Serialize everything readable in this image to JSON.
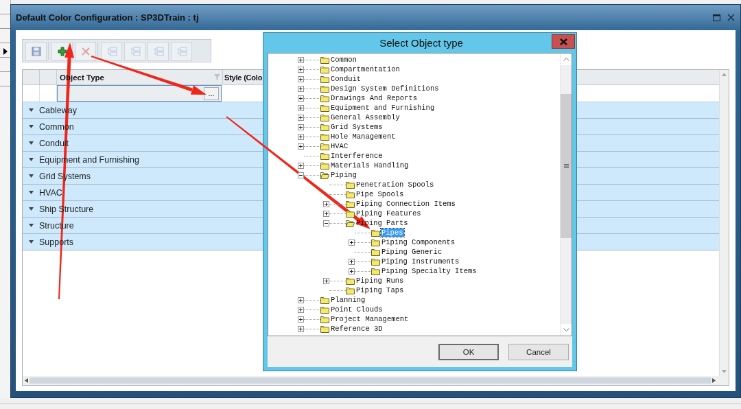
{
  "window": {
    "title": "Default Color Configuration : SP3DTrain : tj"
  },
  "toolbar": {
    "groups": [
      [
        {
          "kind": "save",
          "disabled": false
        }
      ],
      [
        {
          "kind": "add",
          "disabled": false
        },
        {
          "kind": "delete",
          "disabled": true
        }
      ],
      [
        {
          "kind": "tree",
          "disabled": true
        },
        {
          "kind": "tree",
          "disabled": true
        },
        {
          "kind": "tree",
          "disabled": true
        },
        {
          "kind": "tree",
          "disabled": true
        }
      ]
    ]
  },
  "grid": {
    "columns": [
      {
        "label": "Object Type",
        "filter_icon": true
      },
      {
        "label": "Style (Colo",
        "filter_icon": false
      }
    ],
    "new_row": {
      "browse_button": "..."
    },
    "groups": [
      {
        "label": "Cableway"
      },
      {
        "label": "Common"
      },
      {
        "label": "Conduit"
      },
      {
        "label": "Equipment and Furnishing"
      },
      {
        "label": "Grid Systems"
      },
      {
        "label": "HVAC"
      },
      {
        "label": "Ship Structure"
      },
      {
        "label": "Structure"
      },
      {
        "label": "Supports"
      }
    ]
  },
  "dialog": {
    "title": "Select Object type",
    "tree": [
      {
        "label": "Common",
        "has_children": true,
        "expanded": false,
        "selected": false
      },
      {
        "label": "Compartmentation",
        "has_children": true,
        "expanded": false,
        "selected": false
      },
      {
        "label": "Conduit",
        "has_children": true,
        "expanded": false,
        "selected": false
      },
      {
        "label": "Design System Definitions",
        "has_children": true,
        "expanded": false,
        "selected": false
      },
      {
        "label": "Drawings And Reports",
        "has_children": true,
        "expanded": false,
        "selected": false
      },
      {
        "label": "Equipment and Furnishing",
        "has_children": true,
        "expanded": false,
        "selected": false
      },
      {
        "label": "General Assembly",
        "has_children": true,
        "expanded": false,
        "selected": false
      },
      {
        "label": "Grid Systems",
        "has_children": true,
        "expanded": false,
        "selected": false
      },
      {
        "label": "Hole Management",
        "has_children": true,
        "expanded": false,
        "selected": false
      },
      {
        "label": "HVAC",
        "has_children": true,
        "expanded": false,
        "selected": false
      },
      {
        "label": "Interference",
        "has_children": false,
        "expanded": false,
        "selected": false
      },
      {
        "label": "Materials Handling",
        "has_children": true,
        "expanded": false,
        "selected": false
      },
      {
        "label": "Piping",
        "has_children": true,
        "expanded": true,
        "selected": false,
        "children": [
          {
            "label": "Penetration Spools",
            "has_children": false,
            "expanded": false,
            "selected": false
          },
          {
            "label": "Pipe Spools",
            "has_children": false,
            "expanded": false,
            "selected": false
          },
          {
            "label": "Piping Connection Items",
            "has_children": true,
            "expanded": false,
            "selected": false
          },
          {
            "label": "Piping Features",
            "has_children": true,
            "expanded": false,
            "selected": false
          },
          {
            "label": "Piping Parts",
            "has_children": true,
            "expanded": true,
            "selected": false,
            "children": [
              {
                "label": "Pipes",
                "has_children": false,
                "expanded": false,
                "selected": true
              },
              {
                "label": "Piping Components",
                "has_children": true,
                "expanded": false,
                "selected": false
              },
              {
                "label": "Piping Generic",
                "has_children": false,
                "expanded": false,
                "selected": false
              },
              {
                "label": "Piping Instruments",
                "has_children": true,
                "expanded": false,
                "selected": false
              },
              {
                "label": "Piping Specialty Items",
                "has_children": true,
                "expanded": false,
                "selected": false
              }
            ]
          },
          {
            "label": "Piping Runs",
            "has_children": true,
            "expanded": false,
            "selected": false
          },
          {
            "label": "Piping Taps",
            "has_children": false,
            "expanded": false,
            "selected": false
          }
        ]
      },
      {
        "label": "Planning",
        "has_children": true,
        "expanded": false,
        "selected": false
      },
      {
        "label": "Point Clouds",
        "has_children": true,
        "expanded": false,
        "selected": false
      },
      {
        "label": "Project Management",
        "has_children": true,
        "expanded": false,
        "selected": false
      },
      {
        "label": "Reference 3D",
        "has_children": true,
        "expanded": false,
        "selected": false
      }
    ],
    "buttons": [
      {
        "label": "OK",
        "default": true
      },
      {
        "label": "Cancel",
        "default": false
      }
    ]
  }
}
